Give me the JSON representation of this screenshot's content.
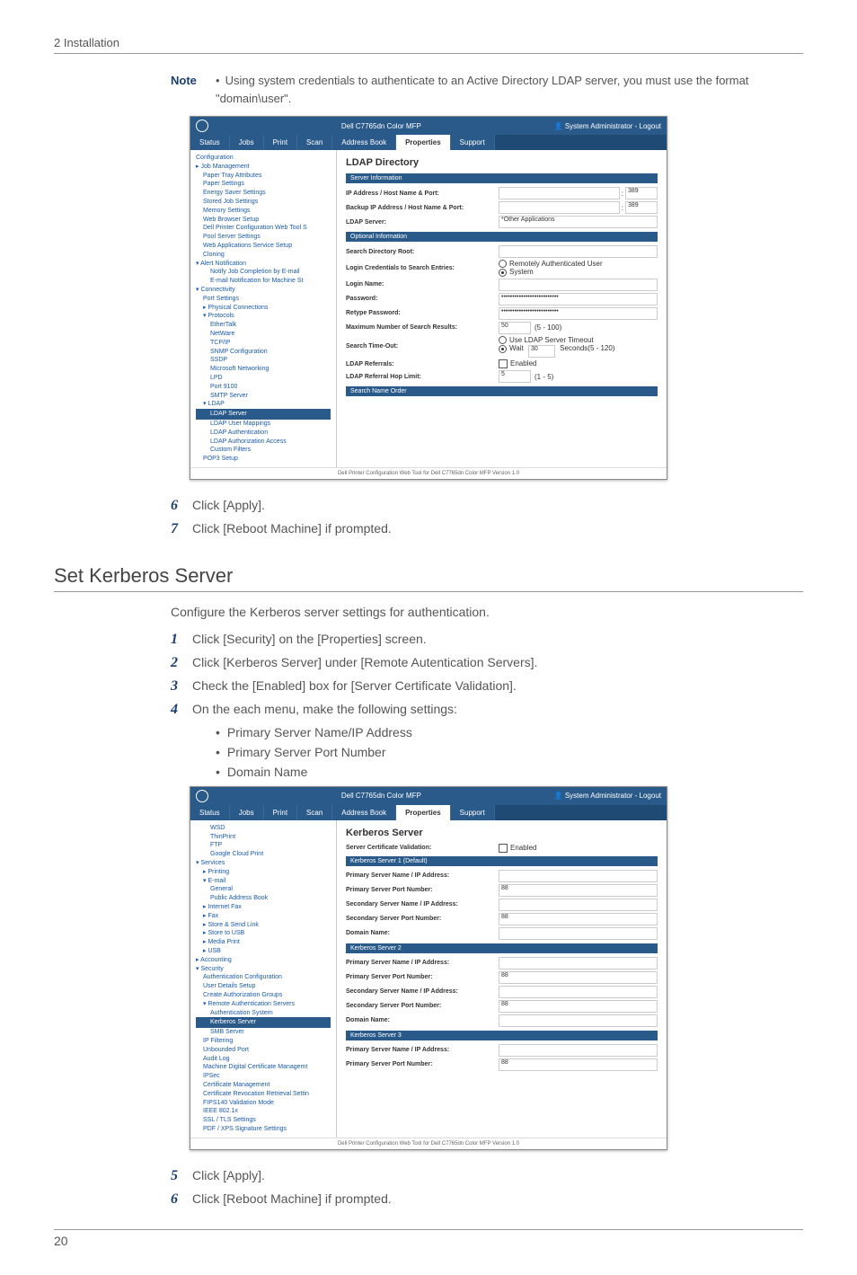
{
  "header": "2 Installation",
  "note": {
    "label": "Note",
    "text": "Using system credentials to authenticate to an Active Directory LDAP server, you must use the format \"domain\\user\"."
  },
  "screenshot1": {
    "product": "Dell C7765dn Color MFP",
    "userinfo": "System Administrator - Logout",
    "tabs": [
      "Status",
      "Jobs",
      "Print",
      "Scan",
      "Address Book",
      "Properties",
      "Support"
    ],
    "side": [
      "Configuration",
      "▸ Job Management",
      "Paper Tray Attributes",
      "Paper Settings",
      "Energy Saver Settings",
      "Stored Job Settings",
      "Memory Settings",
      "Web Browser Setup",
      "Dell Printer Configuration Web Tool S",
      "Pool Server Settings",
      "Web Applications Service Setup",
      "Cloning",
      "▾ Alert Notification",
      "Notify Job Completion by E-mail",
      "E-mail Notification for Machine St",
      "▾ Connectivity",
      "Port Settings",
      "▸ Physical Connections",
      "▾ Protocols",
      "EtherTalk",
      "NetWare",
      "TCP/IP",
      "SNMP Configuration",
      "SSDP",
      "Microsoft Networking",
      "LPD",
      "Port 9100",
      "SMTP Server",
      "▾ LDAP",
      "LDAP Server",
      "LDAP User Mappings",
      "LDAP Authentication",
      "LDAP Authorization Access",
      "Custom Filters",
      "POP3 Setup"
    ],
    "title": "LDAP Directory",
    "sections": {
      "server_info": "Server Information",
      "optional_info": "Optional Information",
      "search_name_order": "Search Name Order"
    },
    "fields": {
      "ip": {
        "label": "IP Address / Host Name & Port:",
        "port": "389"
      },
      "backup": {
        "label": "Backup IP Address / Host Name & Port:",
        "port": "389"
      },
      "ldapserver": {
        "label": "LDAP Server:",
        "value": "*Other Applications"
      },
      "root": {
        "label": "Search Directory Root:"
      },
      "cred": {
        "label": "Login Credentials to Search Entries:",
        "opt1": "Remotely Authenticated User",
        "opt2": "System"
      },
      "login": {
        "label": "Login Name:"
      },
      "pass": {
        "label": "Password:",
        "value": "••••••••••••••••••••••••••"
      },
      "retype": {
        "label": "Retype Password:",
        "value": "••••••••••••••••••••••••••"
      },
      "maxr": {
        "label": "Maximum Number of Search Results:",
        "value": "50",
        "range": "(5 - 100)"
      },
      "timeout": {
        "label": "Search Time-Out:",
        "opt1": "Use LDAP Server Timeout",
        "opt2label": "Wait",
        "opt2val": "30",
        "opt2suffix": "Seconds(5 - 120)"
      },
      "referrals": {
        "label": "LDAP Referrals:",
        "opt": "Enabled"
      },
      "hop": {
        "label": "LDAP Referral Hop Limit:",
        "value": "5",
        "range": "(1 - 5)"
      }
    },
    "footer": "Dell Printer Configuration Web Tool for Dell C7765dn Color MFP Version 1.0"
  },
  "steps1": {
    "s6": "Click [Apply].",
    "s7": "Click [Reboot Machine] if prompted."
  },
  "section2": {
    "heading": "Set Kerberos Server",
    "intro": "Configure the Kerberos server settings for authentication.",
    "s1": "Click [Security] on the [Properties] screen.",
    "s2": "Click [Kerberos Server] under [Remote Autentication Servers].",
    "s3": "Check the [Enabled] box for [Server Certificate Validation].",
    "s4": "On the each menu, make the following settings:",
    "bullets": [
      "Primary Server Name/IP Address",
      "Primary Server Port Number",
      "Domain Name"
    ]
  },
  "screenshot2": {
    "product": "Dell C7765dn Color MFP",
    "userinfo": "System Administrator - Logout",
    "tabs": [
      "Status",
      "Jobs",
      "Print",
      "Scan",
      "Address Book",
      "Properties",
      "Support"
    ],
    "side": [
      "WSD",
      "ThinPrint",
      "FTP",
      "Google Cloud Print",
      "▾ Services",
      "▸ Printing",
      "▾ E-mail",
      "General",
      "Public Address Book",
      "▸ Internet Fax",
      "▸ Fax",
      "▸ Store & Send Link",
      "▸ Store to USB",
      "▸ Media Print",
      "▸ USB",
      "▸ Accounting",
      "▾ Security",
      "Authentication Configuration",
      "User Details Setup",
      "Create Authorization Groups",
      "▾ Remote Authentication Servers",
      "Authentication System",
      "Kerberos Server",
      "SMB Server",
      "IP Filtering",
      "Unbounded Port",
      "Audit Log",
      "Machine Digital Certificate Managemt",
      "IPSec",
      "Certificate Management",
      "Certificate Revocation Retrieval Settin",
      "FIPS140 Validation Mode",
      "IEEE 802.1x",
      "SSL / TLS Settings",
      "PDF / XPS Signature Settings"
    ],
    "title": "Kerberos Server",
    "fields": {
      "cert": {
        "label": "Server Certificate Validation:",
        "opt": "Enabled"
      }
    },
    "sections": {
      "k1": "Kerberos Server 1 (Default)",
      "k2": "Kerberos Server 2",
      "k3": "Kerberos Server 3"
    },
    "rows": {
      "psname": {
        "label": "Primary Server Name / IP Address:"
      },
      "psport": {
        "label": "Primary Server Port Number:",
        "value": "88"
      },
      "ssname": {
        "label": "Secondary Server Name / IP Address:"
      },
      "ssport": {
        "label": "Secondary Server Port Number:",
        "value": "88"
      },
      "domain": {
        "label": "Domain Name:"
      }
    },
    "footer": "Dell Printer Configuration Web Tool for Dell C7765dn Color MFP Version 1.0"
  },
  "steps2": {
    "s5": "Click [Apply].",
    "s6": "Click [Reboot Machine] if prompted."
  },
  "page_number": "20"
}
